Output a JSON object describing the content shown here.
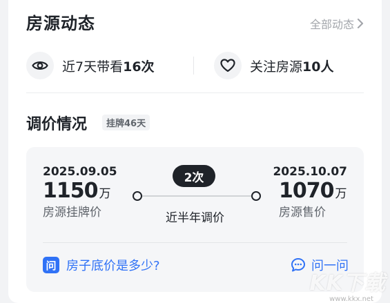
{
  "header": {
    "title": "房源动态",
    "all_link": "全部动态"
  },
  "stats": {
    "viewings_prefix": "近7天带看",
    "viewings_count": "16次",
    "followers_prefix": "关注房源",
    "followers_count": "10人"
  },
  "price_adjust": {
    "title": "调价情况",
    "listed_badge": "挂牌46天",
    "start": {
      "date": "2025.09.05",
      "price": "1150",
      "unit": "万",
      "label": "房源挂牌价"
    },
    "end": {
      "date": "2025.10.07",
      "price": "1070",
      "unit": "万",
      "label": "房源售价"
    },
    "adjust_count": "2次",
    "adjust_caption": "近半年调价"
  },
  "qa": {
    "question_icon": "问",
    "question": "房子底价是多少?",
    "ask_button": "问一问"
  },
  "watermark": {
    "logo": "KK下载",
    "url": "www.kkx.net"
  },
  "colors": {
    "accent": "#3072f6",
    "text": "#1f2329",
    "muted": "#a3a6ab"
  },
  "icons": [
    "eye-icon",
    "heart-icon",
    "chevron-right-icon",
    "question-icon",
    "chat-bubble-icon"
  ]
}
